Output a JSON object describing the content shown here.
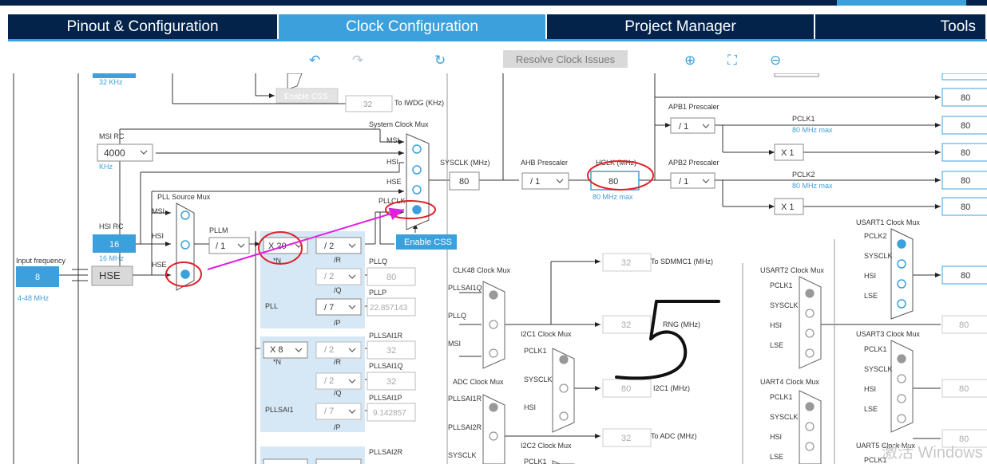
{
  "tabs": [
    {
      "label": "Pinout & Configuration"
    },
    {
      "label": "Clock Configuration"
    },
    {
      "label": "Project Manager"
    },
    {
      "label": "Tools"
    }
  ],
  "toolbar": {
    "resolve_label": "Resolve Clock Issues"
  },
  "diagram": {
    "lse_freq": "32 KHz",
    "enable_css_top": "Enable CSS",
    "iwdg_value": "32",
    "iwdg_label": "To IWDG (KHz)",
    "msi_rc_label": "MSI RC",
    "msi_value": "4000",
    "msi_unit": "KHz",
    "hsi_rc_label": "HSI RC",
    "hsi_value": "16",
    "hsi_freq": "16 MHz",
    "input_freq_label": "Input frequency",
    "input_freq_value": "8",
    "input_freq_range": "4-48 MHz",
    "hse_label": "HSE",
    "pll_source_mux": "PLL Source Mux",
    "mux_msi": "MSI",
    "mux_hsi": "HSI",
    "mux_hse": "HSE",
    "pllm_label": "PLLM",
    "pllm_value": "/ 1",
    "system_clock_mux": "System Clock Mux",
    "scm_msi": "MSI",
    "scm_hsi": "HSI",
    "scm_hse": "HSE",
    "scm_pllclk": "PLLCLK",
    "enable_css": "Enable CSS",
    "sysclk_label": "SYSCLK (MHz)",
    "sysclk_value": "80",
    "ahb_label": "AHB Prescaler",
    "ahb_value": "/ 1",
    "hclk_label": "HCLK (MHz)",
    "hclk_value": "80",
    "hclk_max": "80 MHz max",
    "apb1_label": "APB1 Prescaler",
    "apb1_value": "/ 1",
    "pclk1_label": "PCLK1",
    "pclk1_max": "80 MHz max",
    "apb2_label": "APB2 Prescaler",
    "apb2_value": "/ 1",
    "pclk2_label": "PCLK2",
    "pclk2_max": "80 MHz max",
    "x1": "X 1",
    "out_values": [
      "80",
      "80",
      "80",
      "80",
      "80"
    ],
    "pll_n_value": "X 20",
    "n_label": "*N",
    "pll_r_value": "/ 2",
    "r_label": "/R",
    "pll_q_value": "/ 2",
    "q_label": "/Q",
    "pll_p_value": "/ 7",
    "p_label": "/P",
    "pll_label": "PLL",
    "pllq_label": "PLLQ",
    "pllq_value": "80",
    "pllp_label": "PLLP",
    "pllp_value": "22.857143",
    "sai1_n_value": "X 8",
    "sai1_r_value": "/ 2",
    "sai1_q_value": "/ 2",
    "sai1_p_value": "/ 7",
    "pllsai1_label": "PLLSAI1",
    "pllsai1r_label": "PLLSAI1R",
    "pllsai1r_value": "32",
    "pllsai1q_label": "PLLSAI1Q",
    "pllsai1q_value": "32",
    "pllsai1p_label": "PLLSAI1P",
    "pllsai1p_value": "9.142857",
    "pllsai2r_label": "PLLSAI2R",
    "clk48_mux": "CLK48 Clock Mux",
    "clk48_in": [
      "PLLSAI1Q",
      "PLLQ",
      "MSI"
    ],
    "sdmmc_value": "32",
    "sdmmc_label": "To SDMMC1 (MHz)",
    "rng_value": "32",
    "rng_label": "RNG (MHz)",
    "i2c1_mux": "I2C1 Clock Mux",
    "i2c1_in": [
      "PCLK1",
      "SYSCLK",
      "HSI"
    ],
    "i2c1_value": "80",
    "i2c1_label": "I2C1 (MHz)",
    "adc_mux": "ADC Clock Mux",
    "adc_in": [
      "PLLSAI1R",
      "PLLSAI2R",
      "SYSCLK"
    ],
    "adc_value": "32",
    "adc_label": "To ADC (MHz)",
    "i2c2_mux": "I2C2 Clock Mux",
    "i2c2_in": [
      "PCLK1"
    ],
    "usart1_mux": "USART1 Clock Mux",
    "usart1_in": [
      "PCLK2",
      "SYSCLK",
      "HSI",
      "LSE"
    ],
    "usart1_value": "80",
    "usart2_mux": "USART2 Clock Mux",
    "usart2_in": [
      "PCLK1",
      "SYSCLK",
      "HSI",
      "LSE"
    ],
    "usart2_value": "80",
    "usart3_mux": "USART3 Clock Mux",
    "usart3_in": [
      "PCLK1",
      "SYSCLK",
      "HSI",
      "LSE"
    ],
    "usart3_value": "80",
    "uart4_mux": "UART4 Clock Mux",
    "uart4_in": [
      "PCLK1",
      "SYSCLK",
      "HSI",
      "LSE"
    ],
    "uart5_mux": "UART5 Clock Mux",
    "uart5_in": [
      "PCLK1"
    ],
    "uart5_value": "80",
    "watermark": "激活 Windows"
  }
}
